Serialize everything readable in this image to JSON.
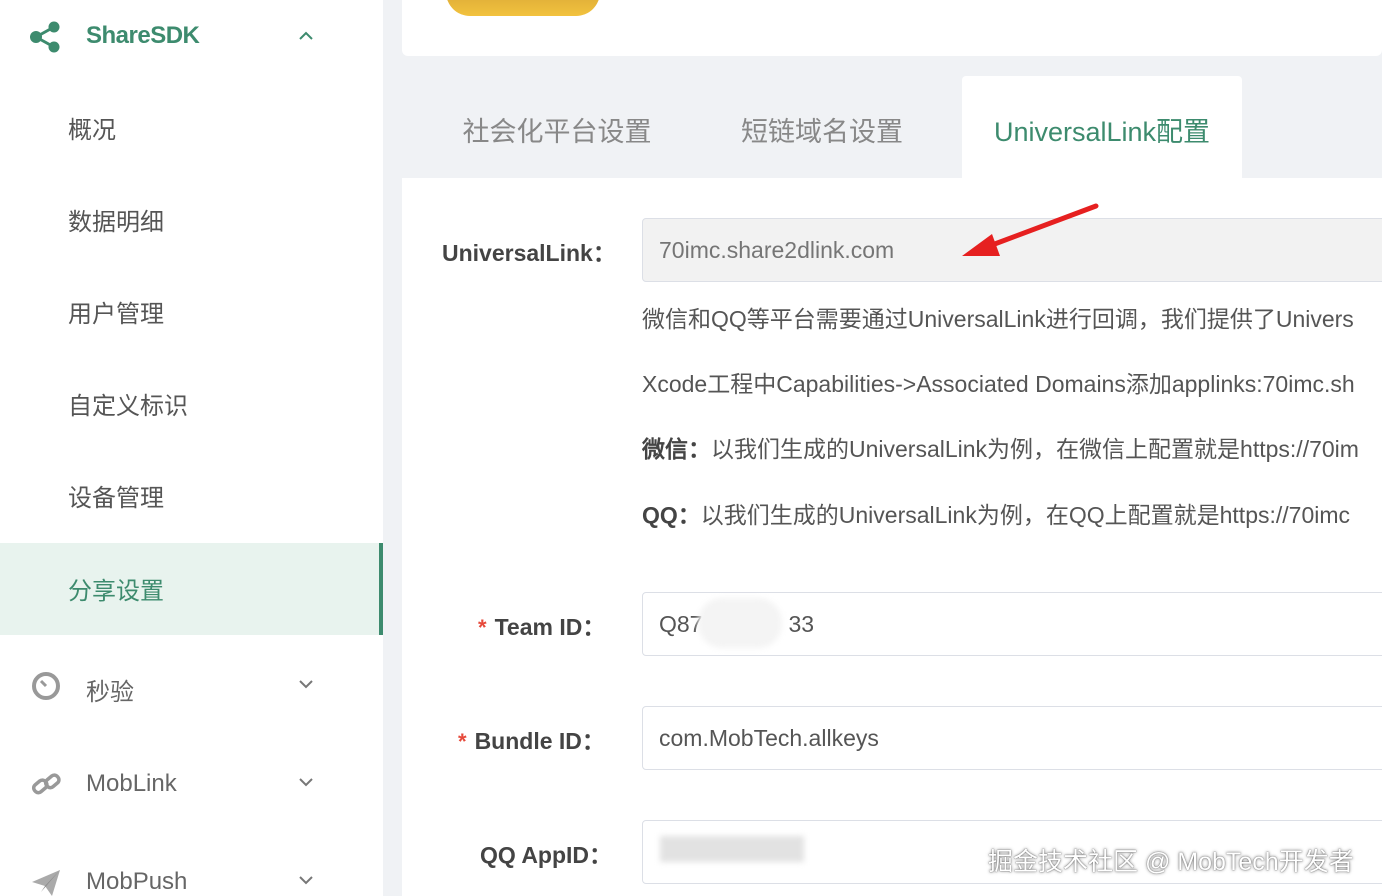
{
  "sidebar": {
    "header": {
      "label": "ShareSDK",
      "icon": "share-icon"
    },
    "sub_items": [
      {
        "label": "概况"
      },
      {
        "label": "数据明细"
      },
      {
        "label": "用户管理"
      },
      {
        "label": "自定义标识"
      },
      {
        "label": "设备管理"
      },
      {
        "label": "分享设置",
        "active": true
      }
    ],
    "groups": [
      {
        "label": "秒验",
        "icon": "clock-icon"
      },
      {
        "label": "MobLink",
        "icon": "link-icon"
      },
      {
        "label": "MobPush",
        "icon": "send-icon"
      }
    ]
  },
  "tabs": [
    {
      "label": "社会化平台设置"
    },
    {
      "label": "短链域名设置"
    },
    {
      "label": "UniversalLink配置",
      "active": true
    }
  ],
  "form": {
    "universal_link": {
      "label": "UniversalLink：",
      "placeholder": "70imc.share2dlink.com"
    },
    "help": {
      "line1": "微信和QQ等平台需要通过UniversalLink进行回调，我们提供了Univers",
      "line2": "Xcode工程中Capabilities->Associated Domains添加applinks:70imc.sh",
      "line3_label": "微信：",
      "line3_text": "以我们生成的UniversalLink为例，在微信上配置就是https://70im",
      "line4_label": "QQ：",
      "line4_text": "以我们生成的UniversalLink为例，在QQ上配置就是https://70imc"
    },
    "team_id": {
      "label": "Team ID：",
      "value_start": "Q87",
      "value_end": "33",
      "required_mark": "*"
    },
    "bundle_id": {
      "label": "Bundle ID：",
      "value": "com.MobTech.allkeys",
      "required_mark": "*"
    },
    "qq_appid": {
      "label": "QQ AppID："
    }
  },
  "watermark": "掘金技术社区 @ MobTech开发者",
  "colors": {
    "accent": "#3d8b6e",
    "arrow": "#e62020",
    "required": "#e64a3b"
  }
}
